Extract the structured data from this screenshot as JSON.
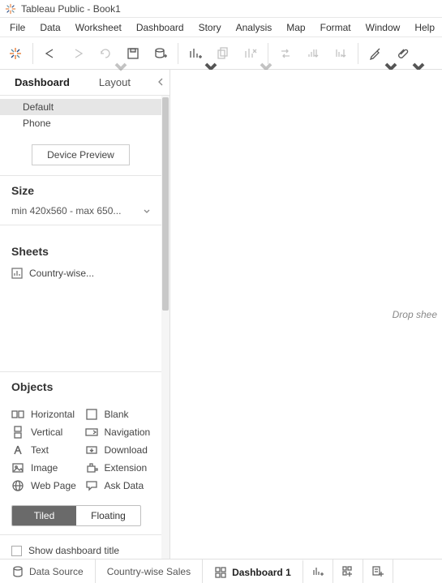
{
  "window": {
    "title": "Tableau Public - Book1"
  },
  "menu": [
    "File",
    "Data",
    "Worksheet",
    "Dashboard",
    "Story",
    "Analysis",
    "Map",
    "Format",
    "Window",
    "Help"
  ],
  "panel": {
    "tabs": {
      "dashboard": "Dashboard",
      "layout": "Layout"
    },
    "devices": {
      "default": "Default",
      "phone": "Phone",
      "preview_button": "Device Preview"
    },
    "size": {
      "title": "Size",
      "value": "min 420x560 - max 650..."
    },
    "sheets": {
      "title": "Sheets",
      "items": [
        "Country-wise..."
      ]
    },
    "objects": {
      "title": "Objects",
      "items": {
        "horizontal": "Horizontal",
        "blank": "Blank",
        "vertical": "Vertical",
        "navigation": "Navigation",
        "text": "Text",
        "download": "Download",
        "image": "Image",
        "extension": "Extension",
        "webpage": "Web Page",
        "askdata": "Ask Data"
      },
      "tiled": "Tiled",
      "floating": "Floating"
    },
    "show_title": "Show dashboard title"
  },
  "canvas": {
    "drop_text": "Drop shee"
  },
  "bottom": {
    "data_source": "Data Source",
    "sheet_tab": "Country-wise Sales",
    "dashboard_tab": "Dashboard 1"
  }
}
